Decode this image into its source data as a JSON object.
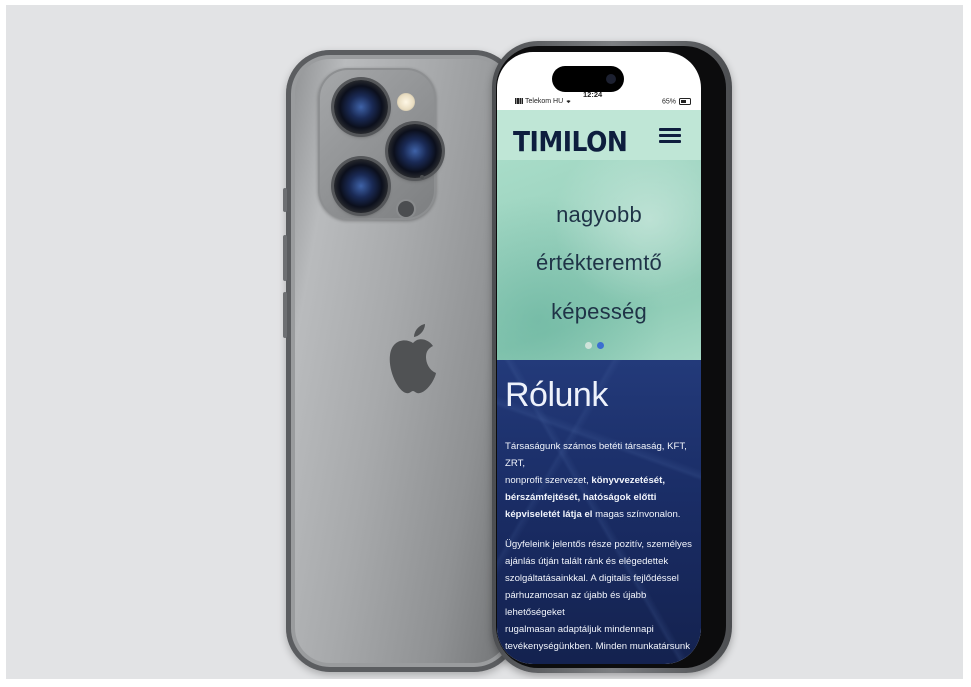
{
  "status_bar": {
    "carrier": "Telekom HU",
    "time": "12:24",
    "battery": "65%"
  },
  "site": {
    "logo": "TIMILON",
    "hero_lines": [
      "nagyobb",
      "értékteremtő",
      "képesség"
    ],
    "carousel": {
      "count": 2,
      "active_index": 1
    },
    "about": {
      "title": "Rólunk",
      "p1": [
        "Társaságunk  számos betéti társaság, KFT, ZRT,",
        "nonprofit szervezet, ",
        "könyvvezetését,",
        "bérszámfejtését, hatóságok előtti",
        "képviseletét látja el",
        " magas színvonalon."
      ],
      "p2": [
        "Ügyfeleink jelentős része pozitív, személyes",
        "ajánlás útján talált ránk és elégedettek",
        "szolgáltatásainkkal. A digitalis fejlődéssel",
        "párhuzamosan  az újabb és újabb lehetőségeket",
        "rugalmasan adaptáljuk mindennapi",
        "tevékenységünkben. Minden munkatársunk"
      ]
    }
  },
  "icons": {
    "menu": "hamburger-menu-icon",
    "logo_back": "apple-logo-icon"
  },
  "colors": {
    "header_bg": "#bfe6d6",
    "logo": "#0e1e3e",
    "about_bg": "#1a2d66",
    "dot_active": "#3b6fd1",
    "dot_inactive": "#cfe3da"
  }
}
